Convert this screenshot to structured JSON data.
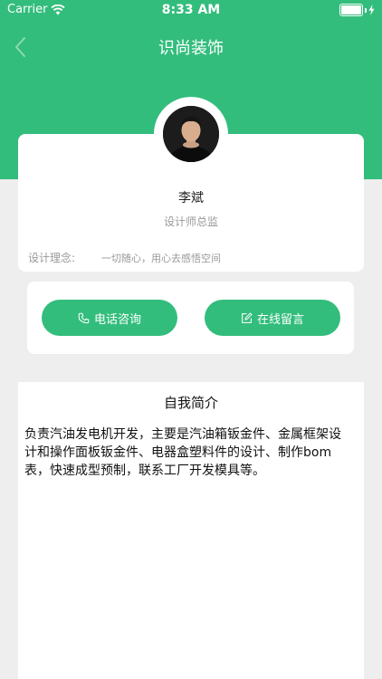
{
  "status_bar": {
    "carrier": "Carrier",
    "time": "8:33 AM"
  },
  "nav": {
    "title": "识尚装饰",
    "back_icon": "chevron-left-icon"
  },
  "profile": {
    "name": "李斌",
    "role": "设计师总监",
    "philosophy_label": "设计理念:",
    "philosophy_value": "一切随心，用心去感悟空间"
  },
  "actions": {
    "call_label": "电话咨询",
    "call_icon": "phone-icon",
    "message_label": "在线留言",
    "message_icon": "edit-icon"
  },
  "intro": {
    "title": "自我简介",
    "text": "负责汽油发电机开发，主要是汽油箱钣金件、金属框架设计和操作面板钣金件、电器盒塑料件的设计、制作bom表，快速成型预制，联系工厂开发模具等。"
  },
  "colors": {
    "accent": "#33bd7c",
    "background": "#eeeeee"
  }
}
